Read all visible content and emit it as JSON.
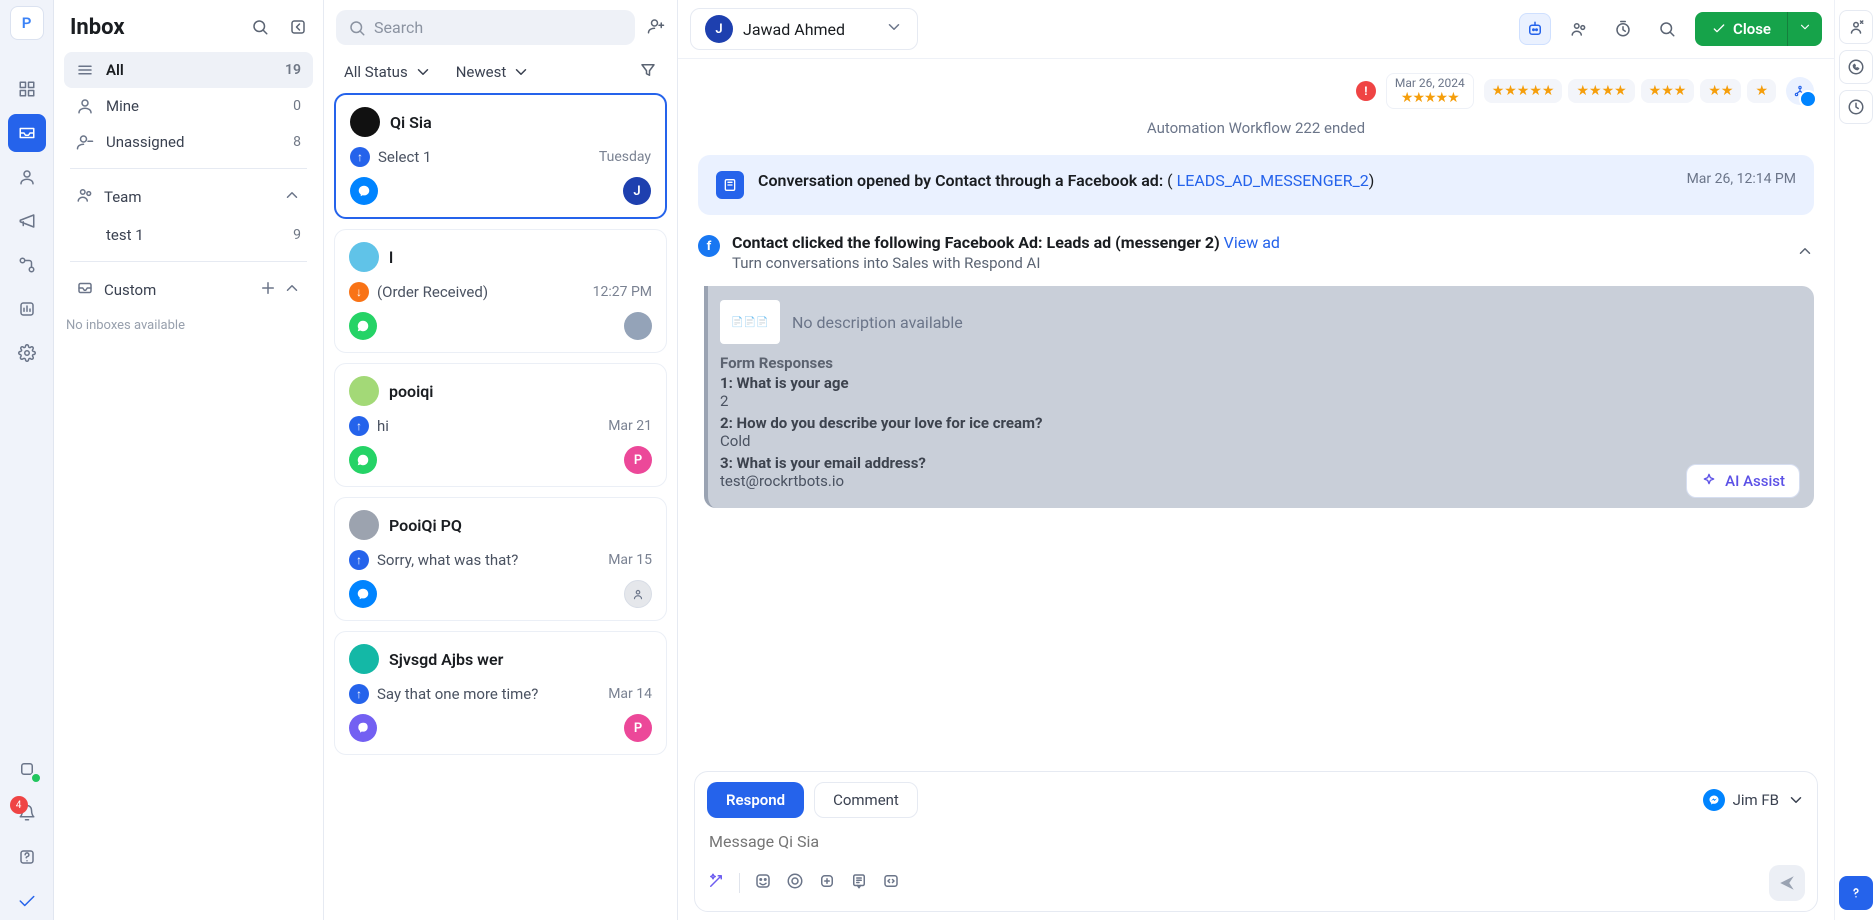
{
  "org_initial": "P",
  "rail": {
    "notification_count": "4"
  },
  "inbox": {
    "title": "Inbox",
    "filters": {
      "all": {
        "label": "All",
        "count": "19"
      },
      "mine": {
        "label": "Mine",
        "count": "0"
      },
      "unassigned": {
        "label": "Unassigned",
        "count": "8"
      }
    },
    "team_section": "Team",
    "teams": [
      {
        "label": "test 1",
        "count": "9"
      }
    ],
    "custom_section": "Custom",
    "empty": "No inboxes available"
  },
  "list": {
    "search_placeholder": "Search",
    "status_filter": "All Status",
    "sort": "Newest",
    "items": [
      {
        "name": "Qi Sia",
        "preview": "Select 1",
        "time": "Tuesday",
        "dir": "up",
        "channel": "fb",
        "avatar_bg": "#111",
        "avatar_txt": "",
        "assignee_bg": "#1e40af",
        "assignee_txt": "J",
        "selected": true
      },
      {
        "name": "l",
        "preview": "(Order Received)",
        "time": "12:27 PM",
        "dir": "down",
        "channel": "wa",
        "avatar_bg": "#60c3e8",
        "avatar_txt": "",
        "assignee_bg": "#fff",
        "assignee_txt": "",
        "selected": false,
        "assignee_img": true
      },
      {
        "name": "pooiqi",
        "preview": "hi",
        "time": "Mar 21",
        "dir": "up",
        "channel": "wa",
        "avatar_bg": "#a3d977",
        "avatar_txt": "",
        "assignee_bg": "#ec4899",
        "assignee_txt": "P",
        "selected": false
      },
      {
        "name": "PooiQi PQ",
        "preview": "Sorry, what was that?",
        "time": "Mar 15",
        "dir": "up",
        "channel": "fb",
        "avatar_bg": "#9ca3af",
        "avatar_txt": "",
        "assignee_bg": "#e5e7eb",
        "assignee_txt": "",
        "selected": false,
        "assignee_generic": true
      },
      {
        "name": "Sjvsgd Ajbs wer",
        "preview": "Say that one more time?",
        "time": "Mar 14",
        "dir": "up",
        "channel": "vi",
        "avatar_bg": "#14b8a6",
        "avatar_txt": "",
        "assignee_bg": "#ec4899",
        "assignee_txt": "P",
        "selected": false
      }
    ]
  },
  "conversation": {
    "contact_initial": "J",
    "contact_name": "Jawad Ahmed",
    "close_label": "Close",
    "top_date": "Mar 26, 2024",
    "system_msg": "Automation Workflow 222 ended",
    "open_event": {
      "prefix": "Conversation opened by Contact through a Facebook ad:",
      "link": "LEADS_AD_MESSENGER_2",
      "time": "Mar 26, 12:14 PM"
    },
    "ad_event": {
      "line1": "Contact clicked the following Facebook Ad: Leads ad (messenger 2)",
      "view": "View ad",
      "line2": "Turn conversations into Sales with Respond AI",
      "no_desc": "No description available",
      "form_title": "Form Responses",
      "qa": [
        {
          "q": "1: What is your age",
          "a": "2"
        },
        {
          "q": "2: How do you describe your love for ice cream?",
          "a": "Cold"
        },
        {
          "q": "3: What is your email address?",
          "a": "test@rockrtbots.io"
        }
      ],
      "ai_assist": "AI Assist"
    },
    "composer": {
      "respond": "Respond",
      "comment": "Comment",
      "channel": "Jim FB",
      "placeholder": "Message Qi Sia"
    }
  }
}
